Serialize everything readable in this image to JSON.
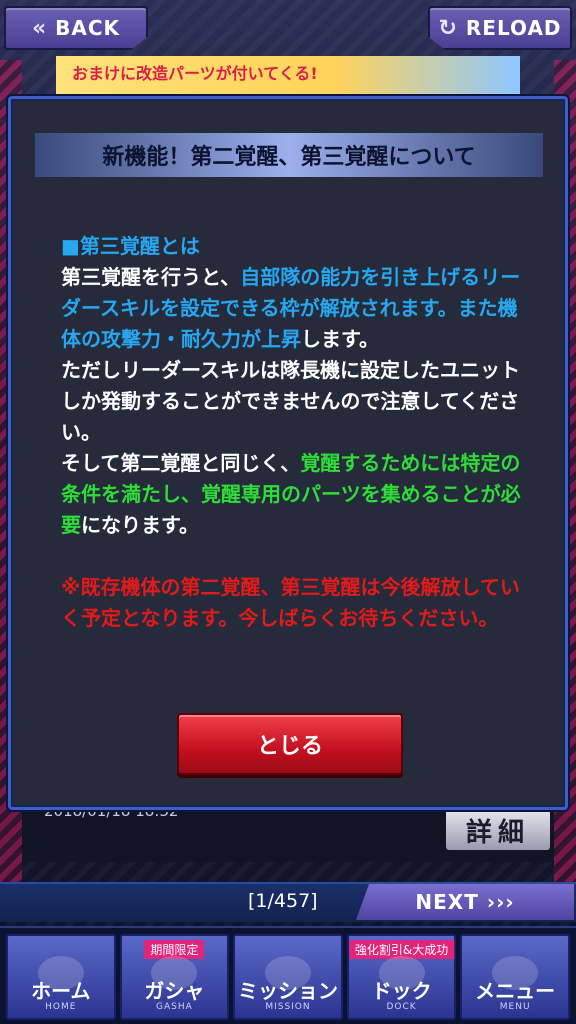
{
  "top": {
    "back_label": "BACK",
    "reload_label": "RELOAD",
    "back_icon": "double-chevron-left-icon",
    "reload_icon": "reload-icon"
  },
  "banner": {
    "text": "おまけに改造パーツが付いてくる!"
  },
  "background": {
    "date_text": "2018/01/18 18:32",
    "detail_label": "詳細"
  },
  "modal": {
    "title": "新機能！第二覚醒、第三覚醒について",
    "heading": "■第三覚醒とは",
    "p1_a": "第三覚醒を行うと、",
    "p1_b": "自部隊の能力を引き上げるリーダースキルを設定できる枠が解放されます。また機体の攻撃力・耐久力が上昇",
    "p1_c": "します。",
    "p2": "ただしリーダースキルは隊長機に設定したユニットしか発動することができませんので注意してください。",
    "p3_a": "そして第二覚醒と同じく、",
    "p3_b": "覚醒するためには特定の条件を満たし、覚醒専用のパーツを集めることが必要",
    "p3_c": "になります。",
    "note": "※既存機体の第二覚醒、第三覚醒は今後解放していく予定となります。今しばらくお待ちください。",
    "close_label": "とじる"
  },
  "pager": {
    "count": "[1/457]",
    "next_label": "NEXT",
    "next_icon": "triple-chevron-right-icon"
  },
  "nav": {
    "items": [
      {
        "label": "ホーム",
        "sub": "HOME",
        "tag": ""
      },
      {
        "label": "ガシャ",
        "sub": "GASHA",
        "tag": "期間限定"
      },
      {
        "label": "ミッション",
        "sub": "MISSION",
        "tag": ""
      },
      {
        "label": "ドック",
        "sub": "DOCK",
        "tag": "強化割引&大成功"
      },
      {
        "label": "メニュー",
        "sub": "MENU",
        "tag": ""
      }
    ]
  },
  "colors": {
    "blue_text": "#27a7f0",
    "green_text": "#2fdc38",
    "red_text": "#e21a1a",
    "close_button": "#c3101e"
  }
}
